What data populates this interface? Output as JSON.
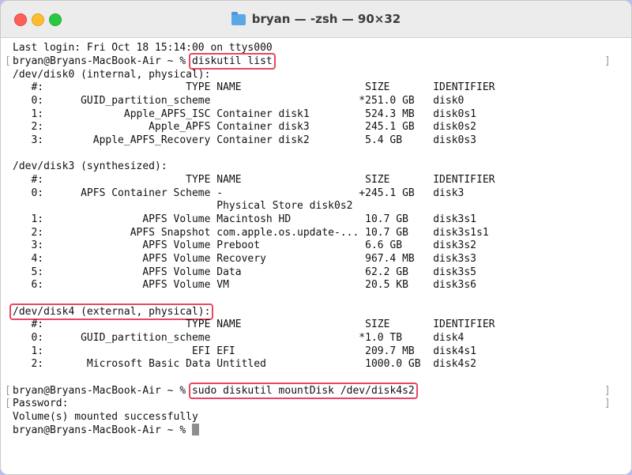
{
  "window": {
    "title": "bryan — -zsh — 90×32",
    "icon": "folder-icon"
  },
  "terminal": {
    "lines": [
      "Last login: Fri Oct 18 15:14:00 on ttys000",
      "bryan@Bryans-MacBook-Air ~ % ",
      "/dev/disk0 (internal, physical):",
      "   #:                       TYPE NAME                    SIZE       IDENTIFIER",
      "   0:      GUID_partition_scheme                        *251.0 GB   disk0",
      "   1:             Apple_APFS_ISC Container disk1         524.3 MB   disk0s1",
      "   2:                 Apple_APFS Container disk3         245.1 GB   disk0s2",
      "   3:        Apple_APFS_Recovery Container disk2         5.4 GB     disk0s3",
      "",
      "/dev/disk3 (synthesized):",
      "   #:                       TYPE NAME                    SIZE       IDENTIFIER",
      "   0:      APFS Container Scheme -                      +245.1 GB   disk3",
      "                                 Physical Store disk0s2",
      "   1:                APFS Volume Macintosh HD            10.7 GB    disk3s1",
      "   2:              APFS Snapshot com.apple.os.update-... 10.7 GB    disk3s1s1",
      "   3:                APFS Volume Preboot                 6.6 GB     disk3s2",
      "   4:                APFS Volume Recovery                967.4 MB   disk3s3",
      "   5:                APFS Volume Data                    62.2 GB    disk3s5",
      "   6:                APFS Volume VM                      20.5 KB    disk3s6",
      "",
      "/dev/disk4 (external, physical):",
      "   #:                       TYPE NAME                    SIZE       IDENTIFIER",
      "   0:      GUID_partition_scheme                        *1.0 TB     disk4",
      "   1:                        EFI EFI                     209.7 MB   disk4s1",
      "   2:       Microsoft Basic Data Untitled                1000.0 GB  disk4s2",
      "",
      "bryan@Bryans-MacBook-Air ~ % ",
      "Password:",
      "Volume(s) mounted successfully",
      "bryan@Bryans-MacBook-Air ~ % "
    ],
    "commands": {
      "list": "diskutil list",
      "mount": "sudo diskutil mountDisk /dev/disk4s2"
    },
    "highlight_color": "#e8475f"
  }
}
